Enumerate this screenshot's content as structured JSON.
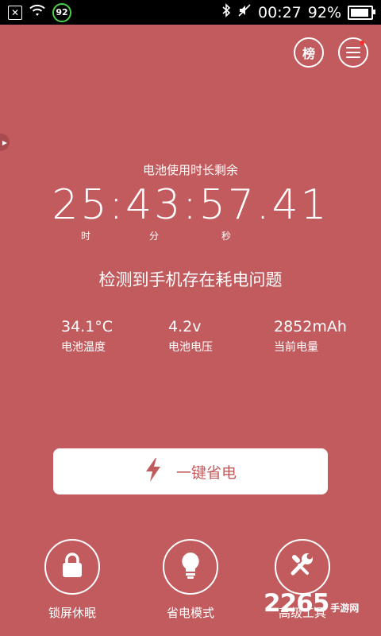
{
  "status_bar": {
    "notification_badge": "92",
    "time": "00:27",
    "battery_percent": "92%",
    "battery_level": 0.92,
    "icons": [
      "close-box-icon",
      "wifi-icon",
      "bluetooth-icon",
      "mute-icon",
      "battery-icon"
    ]
  },
  "header": {
    "rank_label": "榜",
    "menu_icon": "menu-icon",
    "notification_dot_color": "#ff2a2a"
  },
  "side_tab": {
    "icon": "chevron-right-icon"
  },
  "timer": {
    "label": "电池使用时长剩余",
    "display": "25:43:57.41",
    "unit_hour": "时",
    "unit_minute": "分",
    "unit_second": "秒"
  },
  "issue_text": "检测到手机存在耗电问题",
  "stats": [
    {
      "value": "34.1°C",
      "label": "电池温度"
    },
    {
      "value": "4.2v",
      "label": "电池电压"
    },
    {
      "value": "2852mAh",
      "label": "当前电量"
    }
  ],
  "save_button": {
    "label": "一键省电",
    "icon": "lightning-icon"
  },
  "tools": [
    {
      "label": "锁屏休眠",
      "icon": "lock-icon"
    },
    {
      "label": "省电模式",
      "icon": "lightbulb-icon"
    },
    {
      "label": "高级工具",
      "icon": "wrench-icon"
    }
  ],
  "watermark": {
    "number": "2265",
    "line1": "手游网",
    "line2": ""
  },
  "colors": {
    "background": "#c25b5e",
    "button_text": "#c25b5e",
    "status_bar": "#000000",
    "badge_ring": "#4ad04a"
  }
}
